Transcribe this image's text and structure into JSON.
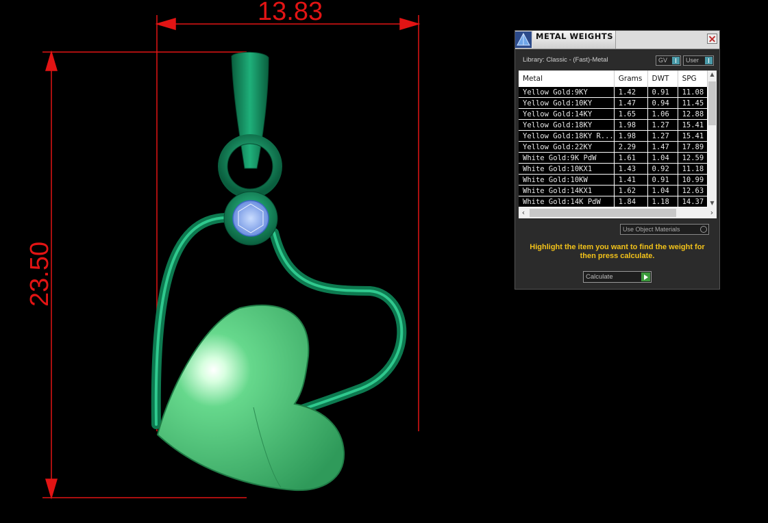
{
  "dimensions": {
    "width_label": "13.83",
    "height_label": "23.50"
  },
  "colors": {
    "dimension": "#e21414",
    "metal": "#0f8a5a",
    "heart": "#55cc7a",
    "gem": "#8ab4ff",
    "hint": "#f2c21a"
  },
  "panel": {
    "title": "METAL WEIGHTS",
    "library_label": "Library: Classic - (Fast)-Metal",
    "toggle_gv": "GV",
    "toggle_user": "User",
    "columns": [
      "Metal",
      "Grams",
      "DWT",
      "SPG"
    ],
    "rows": [
      [
        "Yellow Gold:9KY",
        "1.42",
        "0.91",
        "11.08"
      ],
      [
        "Yellow Gold:10KY",
        "1.47",
        "0.94",
        "11.45"
      ],
      [
        "Yellow Gold:14KY",
        "1.65",
        "1.06",
        "12.88"
      ],
      [
        "Yellow Gold:18KY",
        "1.98",
        "1.27",
        "15.41"
      ],
      [
        "Yellow Gold:18KY R...",
        "1.98",
        "1.27",
        "15.41"
      ],
      [
        "Yellow Gold:22KY",
        "2.29",
        "1.47",
        "17.89"
      ],
      [
        "White Gold:9K PdW",
        "1.61",
        "1.04",
        "12.59"
      ],
      [
        "White Gold:10KX1",
        "1.43",
        "0.92",
        "11.18"
      ],
      [
        "White Gold:10KW",
        "1.41",
        "0.91",
        "10.99"
      ],
      [
        "White Gold:14KX1",
        "1.62",
        "1.04",
        "12.63"
      ],
      [
        "White Gold:14K PdW",
        "1.84",
        "1.18",
        "14.37"
      ]
    ],
    "use_object_materials": "Use Object Materials",
    "hint": "Highlight the item you want to find the weight for then press calculate.",
    "calculate_label": "Calculate"
  }
}
